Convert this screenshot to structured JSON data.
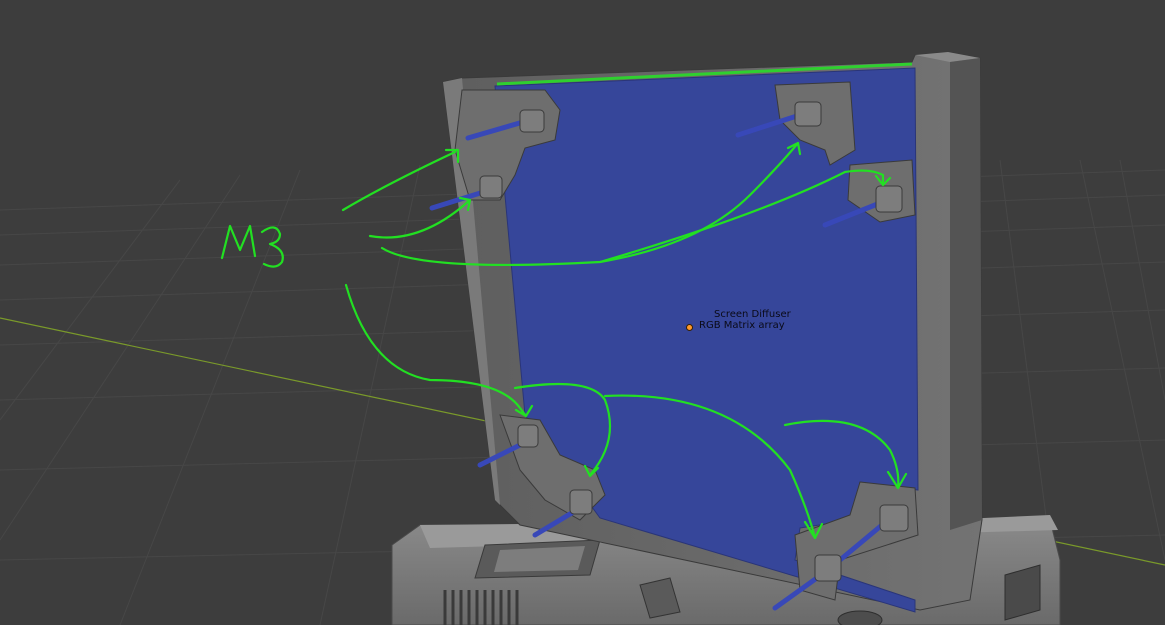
{
  "viewport": {
    "object_labels": [
      "Screen Diffuser",
      "RGB Matrix array"
    ]
  },
  "annotation": {
    "text": "M3",
    "stroke_color": "#22e022"
  },
  "colors": {
    "background": "#3d3d3d",
    "grid_line": "#474747",
    "x_axis": "#7a9a2a",
    "frame_gray": "#6b6b6b",
    "panel_blue": "#36469a",
    "screw_blue": "#3848b8",
    "origin_dot": "#ff9a2a"
  }
}
